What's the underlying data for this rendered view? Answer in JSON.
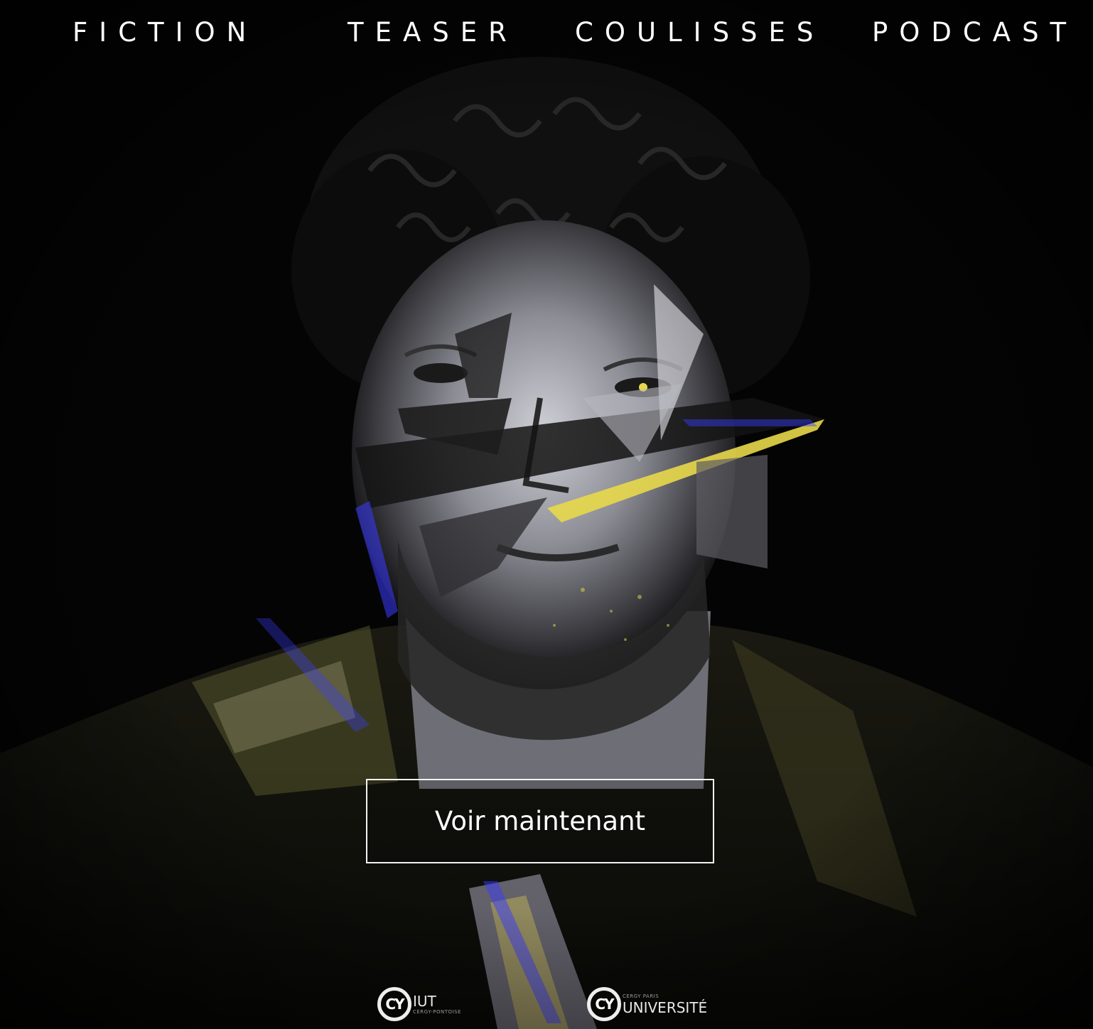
{
  "nav": {
    "items": [
      {
        "label": "FICTION"
      },
      {
        "label": "TEASER"
      },
      {
        "label": "COULISSES"
      },
      {
        "label": "PODCAST"
      }
    ]
  },
  "hero": {
    "cta_label": "Voir maintenant",
    "accent_yellow": "#e8d84a",
    "accent_blue": "#3a3cff",
    "background": "#040404"
  },
  "logos": {
    "iut": {
      "mark": "CY",
      "name": "IUT",
      "sub": "CERGY-PONTOISE"
    },
    "university": {
      "mark": "CY",
      "name": "UNIVERSITÉ",
      "sub": "CERGY PARIS"
    }
  }
}
